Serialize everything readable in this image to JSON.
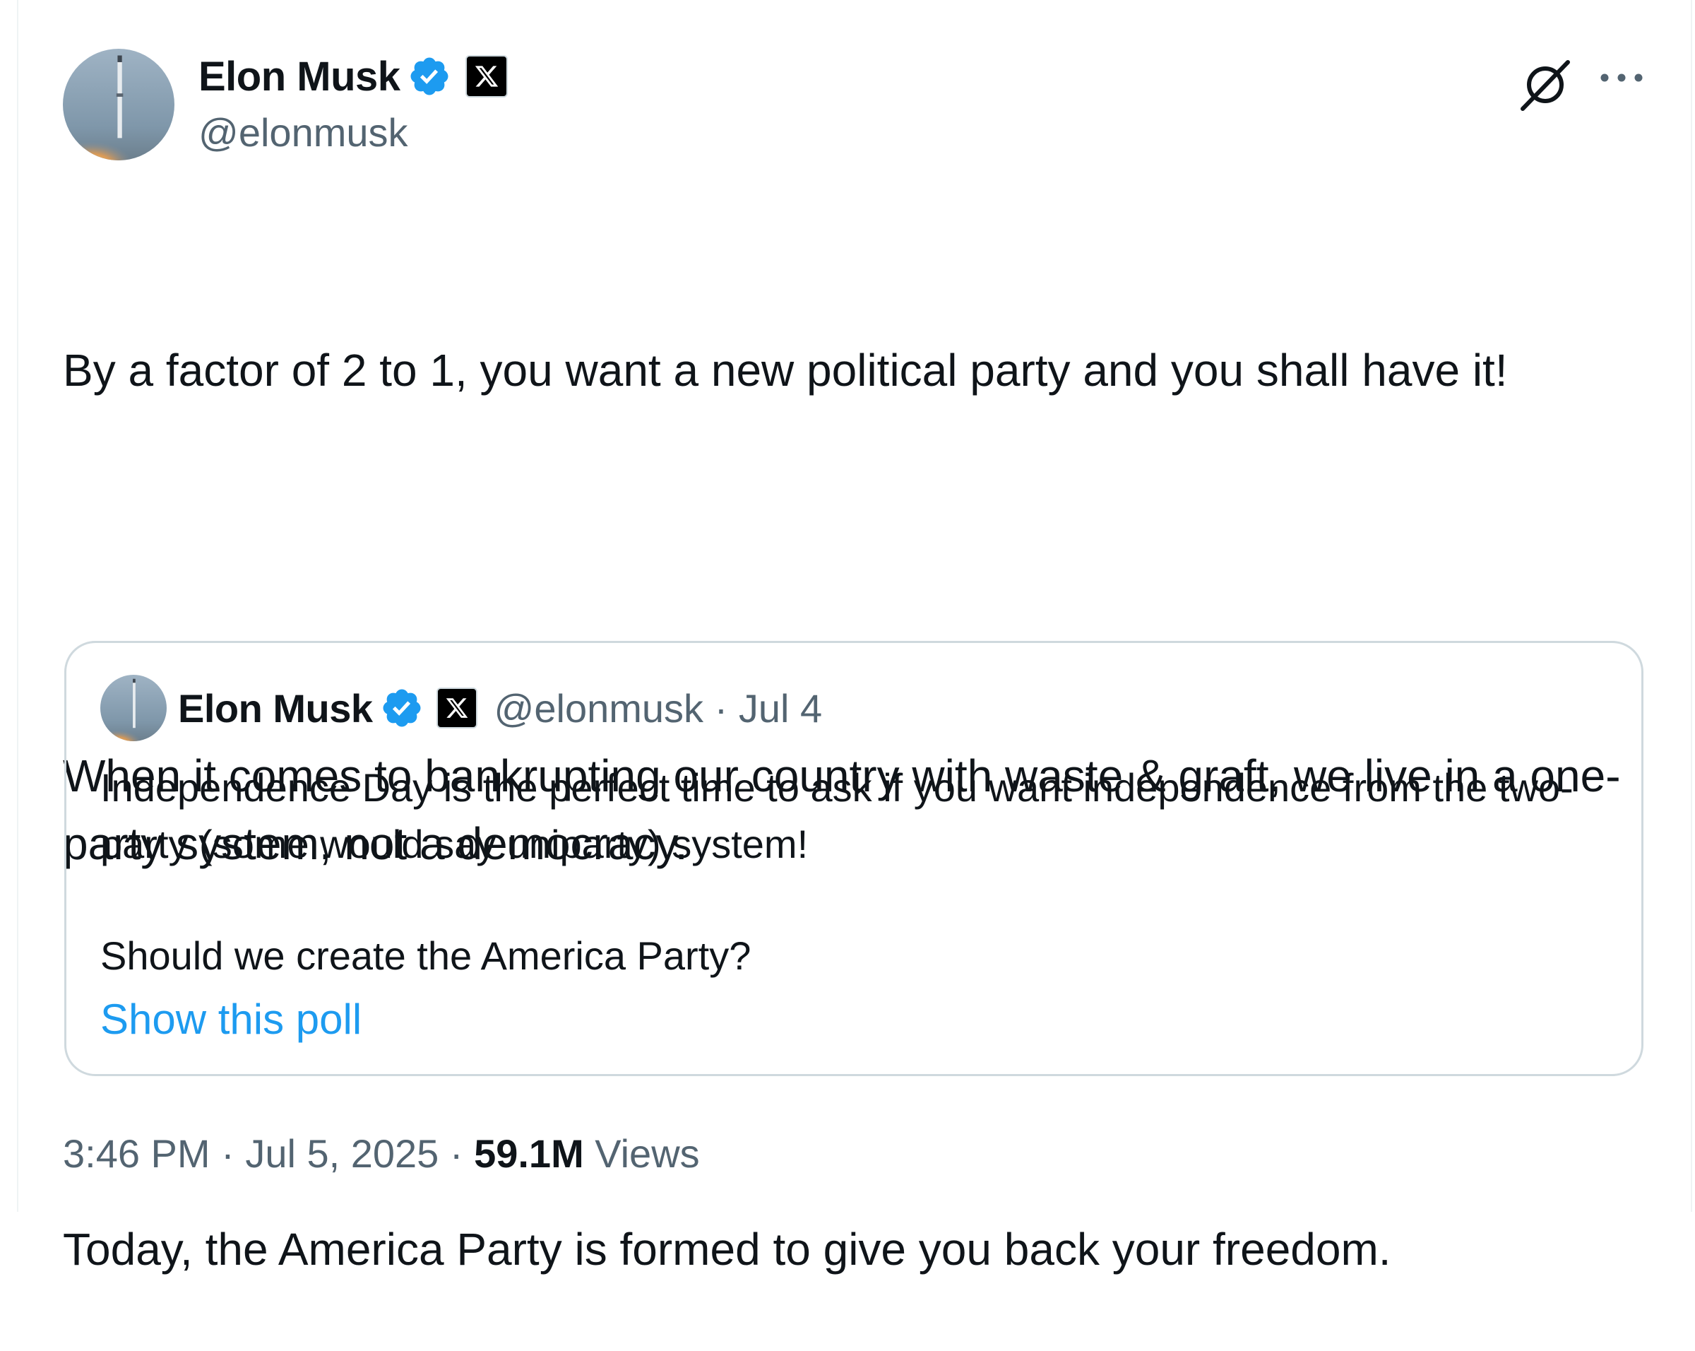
{
  "author": {
    "display_name": "Elon Musk",
    "handle": "@elonmusk"
  },
  "tweet": {
    "paragraphs": [
      "By a factor of 2 to 1, you want a new political party and you shall have it!",
      "When it comes to bankrupting our country with waste & graft, we live in a one-party system, not a democracy.",
      "Today, the America Party is formed to give you back your freedom."
    ]
  },
  "quote": {
    "display_name": "Elon Musk",
    "meta": "@elonmusk · Jul 4",
    "paragraphs": [
      "Independence Day is the perfect time to ask if you want independence from the two-party (some would say uniparty) system!",
      "Should we create the America Party?"
    ],
    "poll_link": "Show this poll"
  },
  "footer": {
    "time_date": "3:46 PM · Jul 5, 2025 · ",
    "views_count": "59.1M",
    "views_label": " Views"
  },
  "icons": {
    "verified": "verified-badge-icon",
    "affiliation": "x-logo-icon",
    "grok": "grok-icon",
    "more": "more-options-icon"
  },
  "colors": {
    "accent": "#1d9bf0",
    "text": "#0f1419",
    "secondary": "#536471",
    "border": "#cfd9de"
  }
}
